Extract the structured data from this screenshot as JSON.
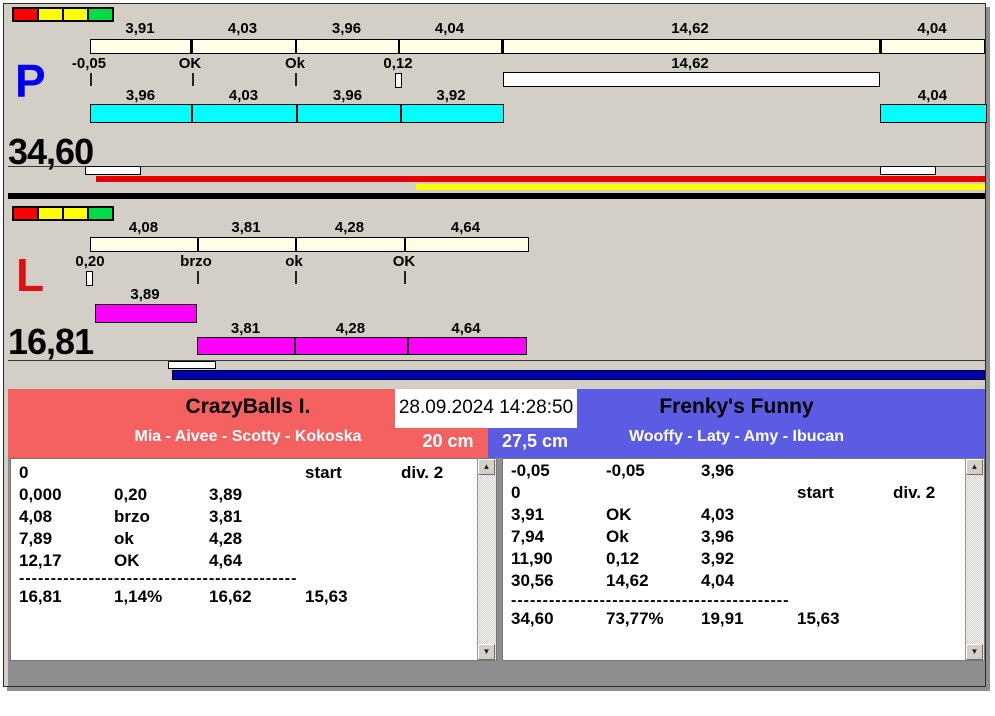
{
  "colors": {
    "window_bg": "#D3CFC6",
    "ideal_bar": "#FFFFE6",
    "lane_p_run_bar": "#00FFFF",
    "lane_l_run_bar": "#FF00FF",
    "progress_red": "#E60000",
    "progress_yellow": "#FFFF00",
    "progress_blue": "#0000B2",
    "lane_p_letter": "#0000F0",
    "lane_l_letter": "#DD1111",
    "team_left_bg": "#F56060",
    "team_right_bg": "#5B5BE3",
    "status_lights": [
      "#FF0000",
      "#FFFF00",
      "#FFFF00",
      "#00DC46"
    ]
  },
  "icons": {
    "arrow_up": "▲",
    "arrow_down": "▼"
  },
  "lane_p": {
    "letter": "P",
    "total": "34,60",
    "ideal_labels": [
      "3,91",
      "4,03",
      "3,96",
      "4,04",
      "14,62",
      "4,04"
    ],
    "mark_labels": [
      "-0,05",
      "OK",
      "Ok",
      "0,12",
      "14,62"
    ],
    "run_labels": [
      "3,96",
      "4,03",
      "3,96",
      "3,92",
      "4,04"
    ]
  },
  "lane_l": {
    "letter": "L",
    "total": "16,81",
    "ideal_labels": [
      "4,08",
      "3,81",
      "4,28",
      "4,64"
    ],
    "mark_labels": [
      "0,20",
      "brzo",
      "ok",
      "OK"
    ],
    "run_label_first": "3,89",
    "run_labels": [
      "3,81",
      "4,28",
      "4,64"
    ]
  },
  "scoreboard": {
    "datetime": "28.09.2024 14:28:50",
    "left": {
      "team": "CrazyBalls I.",
      "dogs": "Mia - Aivee - Scotty - Kokoska",
      "height": "20 cm",
      "rows": [
        [
          "0",
          "",
          "",
          "start",
          "div. 2"
        ],
        [
          "0,000",
          "0,20",
          "3,89",
          "",
          ""
        ],
        [
          "4,08",
          "brzo",
          "3,81",
          "",
          ""
        ],
        [
          "7,89",
          "ok",
          "4,28",
          "",
          ""
        ],
        [
          "12,17",
          "OK",
          "4,64",
          "",
          ""
        ]
      ],
      "separator": "--------------------------------------------------",
      "total_row": [
        "16,81",
        "1,14%",
        "16,62",
        "15,63"
      ]
    },
    "right": {
      "team": "Frenky's Funny",
      "dogs": "Wooffy - Laty - Amy - Ibucan",
      "height": "27,5 cm",
      "rows": [
        [
          "-0,05",
          "-0,05",
          "3,96",
          "",
          ""
        ],
        [
          "0",
          "",
          "",
          "start",
          "div. 2"
        ],
        [
          "3,91",
          "OK",
          "4,03",
          "",
          ""
        ],
        [
          "7,94",
          "Ok",
          "3,96",
          "",
          ""
        ],
        [
          "11,90",
          "0,12",
          "3,92",
          "",
          ""
        ],
        [
          "30,56",
          "14,62",
          "4,04",
          "",
          ""
        ]
      ],
      "separator": "--------------------------------------------------",
      "total_row": [
        "34,60",
        "73,77%",
        "19,91",
        "15,63"
      ]
    }
  }
}
